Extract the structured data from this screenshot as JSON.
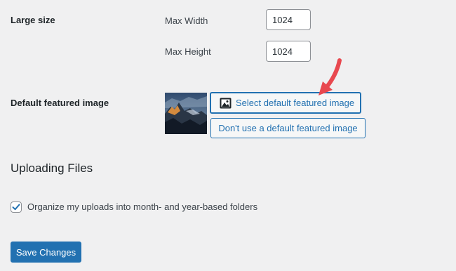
{
  "large_size": {
    "label": "Large size",
    "max_width_label": "Max Width",
    "max_width_value": "1024",
    "max_height_label": "Max Height",
    "max_height_value": "1024"
  },
  "featured_image": {
    "label": "Default featured image",
    "select_button": "Select default featured image",
    "no_default_button": "Don't use a default featured image",
    "select_icon": "image-icon"
  },
  "uploading": {
    "title": "Uploading Files",
    "organize_label": "Organize my uploads into month- and year-based folders",
    "organize_checked": true
  },
  "save_button": "Save Changes",
  "colors": {
    "accent": "#2271b1",
    "annotation_arrow": "#e8484f",
    "background": "#f0f0f1"
  }
}
